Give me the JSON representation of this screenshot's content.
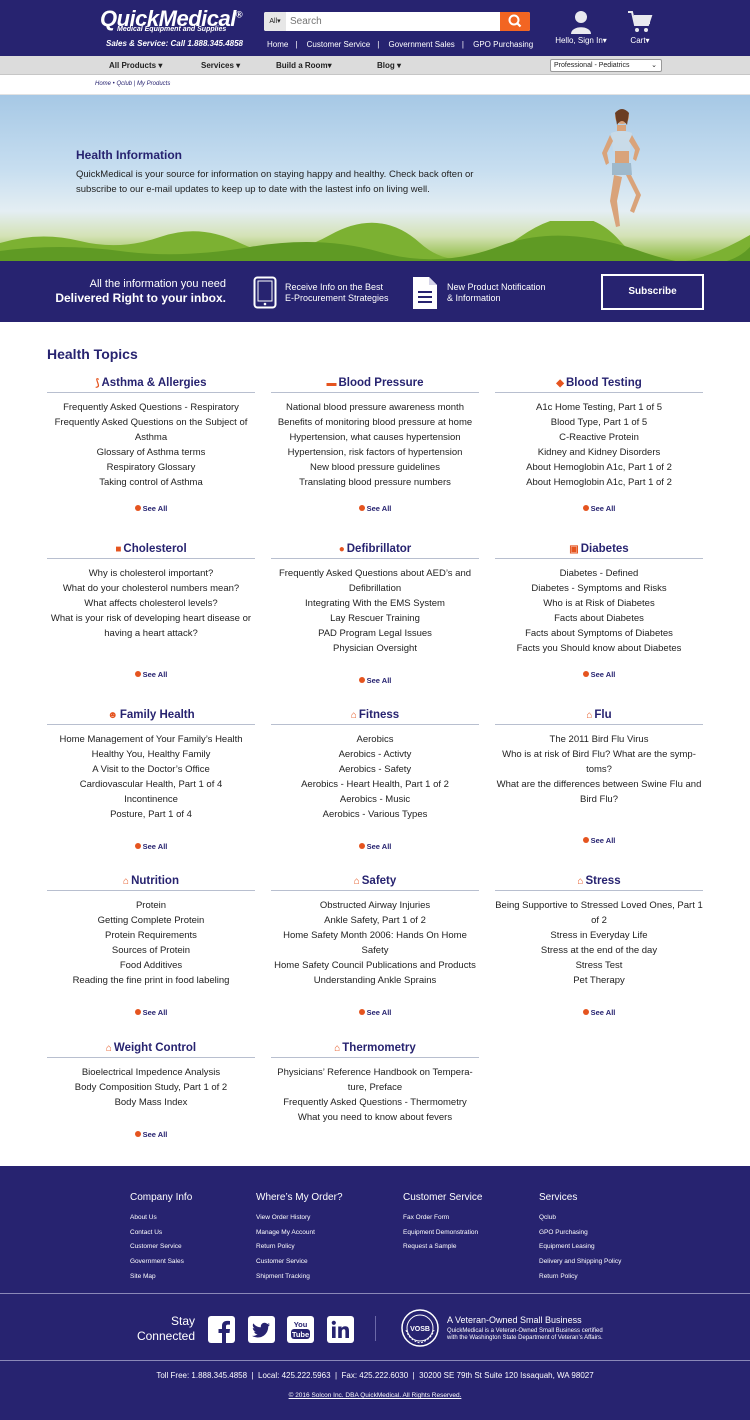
{
  "header": {
    "logo": "QuickMedical",
    "logo_sup": "®",
    "logo_sub": "Medical Equipment and Supplies",
    "phone": "Sales & Service: Call 1.888.345.4858",
    "search_scope": "All",
    "search_placeholder": "Search",
    "nav": [
      "Home",
      "Customer Service",
      "Government Sales",
      "GPO Purchasing"
    ],
    "account": "Hello, Sign In",
    "cart": "Cart"
  },
  "menu": {
    "items": [
      "All Products",
      "Services",
      "Build a Room",
      "Blog"
    ],
    "select_value": "Professional - Pediatrics"
  },
  "breadcrumb": "Home • Qclub | My Products",
  "hero": {
    "title": "Health Information",
    "text": "QuickMedical is your source for information on staying happy and healthy. Check back often or subscribe to our e-mail updates to keep up to date with the lastest info on living well."
  },
  "banner": {
    "line1": "All the information you need",
    "line2": "Delivered Right to your inbox.",
    "feature1_a": "Receive Info on the Best",
    "feature1_b": "E-Procurement Strategies",
    "feature2_a": "New Product Notification",
    "feature2_b": "& Information",
    "subscribe": "Subscribe"
  },
  "topics_title": "Health Topics",
  "see_all": "See All",
  "topics": [
    {
      "title": "Asthma & Allergies",
      "links": [
        "Frequently Asked Questions - Respiratory",
        "Frequently Asked Questions on the Subject of Asthma",
        "Glossary of Asthma terms",
        "Respiratory Glossary",
        "Taking control of Asthma"
      ]
    },
    {
      "title": "Blood Pressure",
      "links": [
        "National blood pressure awareness month",
        "Benefits of monitoring blood pressure at home",
        "Hypertension, what causes hypertension",
        "Hypertension, risk factors of hypertension",
        "New blood pressure guidelines",
        "Translating blood pressure numbers"
      ]
    },
    {
      "title": "Blood Testing",
      "links": [
        "A1c Home Testing, Part 1 of 5",
        "Blood Type, Part 1 of 5",
        "C-Reactive Protein",
        "Kidney and Kidney Disorders",
        "About Hemoglobin A1c, Part 1 of 2",
        "About Hemoglobin A1c, Part 1 of 2"
      ]
    },
    {
      "title": "Cholesterol",
      "links": [
        "Why is cholesterol important?",
        "What do your cholesterol numbers mean?",
        "What affects cholesterol levels?",
        "What is your risk of developing heart disease or having a heart attack?"
      ]
    },
    {
      "title": "Defibrillator",
      "links": [
        "Frequently Asked Questions about AED’s and Defibrillation",
        "Integrating With the EMS System",
        "Lay Rescuer Training",
        "PAD Program Legal Issues",
        "Physician Oversight"
      ]
    },
    {
      "title": "Diabetes",
      "links": [
        "Diabetes - Defined",
        "Diabetes - Symptoms and Risks",
        "Who is at Risk of Diabetes",
        "Facts about Diabetes",
        "Facts about Symptoms of Diabetes",
        "Facts you Should know about Diabetes"
      ]
    },
    {
      "title": "Family Health",
      "links": [
        "Home Management of Your Family’s Health",
        "Healthy You, Healthy Family",
        "A Visit to the Doctor’s Office",
        "Cardiovascular Health, Part 1 of 4",
        "Incontinence",
        "Posture, Part 1 of 4"
      ]
    },
    {
      "title": "Fitness",
      "links": [
        "Aerobics",
        "Aerobics - Activty",
        "Aerobics - Safety",
        "Aerobics - Heart Health, Part 1 of 2",
        "Aerobics - Music",
        "Aerobics - Various Types"
      ]
    },
    {
      "title": "Flu",
      "links": [
        "The 2011 Bird Flu Virus",
        "Who is at risk of Bird Flu? What are the symp-toms?",
        "What are the differences between Swine Flu and Bird Flu?"
      ]
    },
    {
      "title": "Nutrition",
      "links": [
        "Protein",
        "Getting Complete Protein",
        "Protein Requirements",
        "Sources of Protein",
        "Food Additives",
        "Reading the fine print in food labeling"
      ]
    },
    {
      "title": "Safety",
      "links": [
        "Obstructed Airway Injuries",
        "Ankle Safety, Part 1 of 2",
        "Home Safety Month 2006: Hands On Home Safety",
        "Home Safety Council Publications and Products",
        "Understanding Ankle Sprains"
      ]
    },
    {
      "title": "Stress",
      "links": [
        "Being Supportive to Stressed Loved Ones, Part 1 of 2",
        "Stress in Everyday Life",
        "Stress at the end of the day",
        "Stress Test",
        "Pet Therapy"
      ]
    },
    {
      "title": "Weight Control",
      "links": [
        "Bioelectrical Impedence Analysis",
        "Body Composition Study, Part 1 of 2",
        "Body Mass Index"
      ]
    },
    {
      "title": "Thermometry",
      "links": [
        "Physicians’ Reference Handbook on Tempera-ture, Preface",
        "Frequently Asked Questions - Thermometry",
        "What you need to know about fevers"
      ]
    }
  ],
  "footer": {
    "columns": [
      {
        "title": "Company Info",
        "links": [
          "About Us",
          "Contact Us",
          "Customer Service",
          "Government Sales",
          "Site Map"
        ]
      },
      {
        "title": "Where’s My Order?",
        "links": [
          "View Order History",
          "Manage My Account",
          "Return Policy",
          "Customer Service",
          "Shipment Tracking"
        ]
      },
      {
        "title": "Customer Service",
        "links": [
          "Fax Order Form",
          "Equipment Demonstration",
          "Request a Sample"
        ]
      },
      {
        "title": "Services",
        "links": [
          "Qclub",
          "GPO Purchasing",
          "Equipment Leasing",
          "Delivery and Shipping Policy",
          "Return Policy"
        ]
      }
    ],
    "stay_connected_a": "Stay",
    "stay_connected_b": "Connected",
    "social_icons": [
      "facebook-icon",
      "twitter-icon",
      "youtube-icon",
      "linkedin-icon"
    ],
    "seal_text": "VOSB",
    "veteran_title": "A Veteran-Owned Small Business",
    "veteran_text_a": "QuickMedical is a Veteran-Owned Small Business certified",
    "veteran_text_b": "with the Washington State Department of Veteran’s Affairs.",
    "contact": "Toll Free: 1.888.345.4858  |  Local: 425.222.5963  |  Fax: 425.222.6030  |  30200 SE 79th St Suite 120 Issaquah, WA 98027",
    "copyright": "© 2016 Solcon Inc. DBA QuickMedical. All Rights Reserved."
  },
  "colors": {
    "navy": "#272370",
    "orange": "#f26522",
    "accent_icon": "#e5541f"
  }
}
